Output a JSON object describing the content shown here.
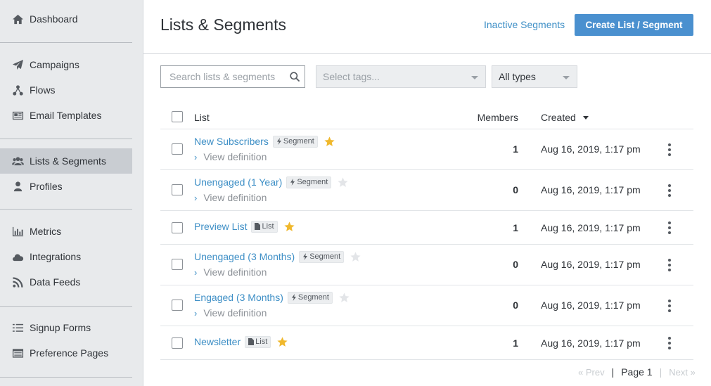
{
  "sidebar": {
    "groups": [
      [
        {
          "label": "Dashboard",
          "icon": "home-icon"
        }
      ],
      [
        {
          "label": "Campaigns",
          "icon": "paper-plane-icon"
        },
        {
          "label": "Flows",
          "icon": "flows-icon"
        },
        {
          "label": "Email Templates",
          "icon": "newspaper-icon"
        }
      ],
      [
        {
          "label": "Lists & Segments",
          "icon": "users-icon",
          "active": true
        },
        {
          "label": "Profiles",
          "icon": "user-icon"
        }
      ],
      [
        {
          "label": "Metrics",
          "icon": "bar-chart-icon"
        },
        {
          "label": "Integrations",
          "icon": "cloud-icon"
        },
        {
          "label": "Data Feeds",
          "icon": "rss-icon"
        }
      ],
      [
        {
          "label": "Signup Forms",
          "icon": "form-list-icon"
        },
        {
          "label": "Preference Pages",
          "icon": "window-icon"
        }
      ]
    ]
  },
  "header": {
    "title": "Lists & Segments",
    "inactive_link": "Inactive Segments",
    "create_button": "Create List / Segment"
  },
  "filters": {
    "search_placeholder": "Search lists & segments",
    "tags_placeholder": "Select tags...",
    "types_value": "All types"
  },
  "table": {
    "columns": {
      "list": "List",
      "members": "Members",
      "created": "Created"
    },
    "view_definition_label": "View definition",
    "rows": [
      {
        "name": "New Subscribers",
        "type": "Segment",
        "starred": true,
        "members": "1",
        "created": "Aug 16, 2019, 1:17 pm"
      },
      {
        "name": "Unengaged (1 Year)",
        "type": "Segment",
        "starred": false,
        "members": "0",
        "created": "Aug 16, 2019, 1:17 pm"
      },
      {
        "name": "Preview List",
        "type": "List",
        "starred": true,
        "members": "1",
        "created": "Aug 16, 2019, 1:17 pm"
      },
      {
        "name": "Unengaged (3 Months)",
        "type": "Segment",
        "starred": false,
        "members": "0",
        "created": "Aug 16, 2019, 1:17 pm"
      },
      {
        "name": "Engaged (3 Months)",
        "type": "Segment",
        "starred": false,
        "members": "0",
        "created": "Aug 16, 2019, 1:17 pm"
      },
      {
        "name": "Newsletter",
        "type": "List",
        "starred": true,
        "members": "1",
        "created": "Aug 16, 2019, 1:17 pm"
      }
    ]
  },
  "pagination": {
    "prev": "« Prev",
    "current": "Page 1",
    "next": "Next »"
  },
  "colors": {
    "accent": "#4a90cf",
    "link": "#3e8fc6",
    "star_on": "#f0b82c",
    "star_off": "#e3e5e8",
    "sidebar_bg": "#e8eaec"
  }
}
